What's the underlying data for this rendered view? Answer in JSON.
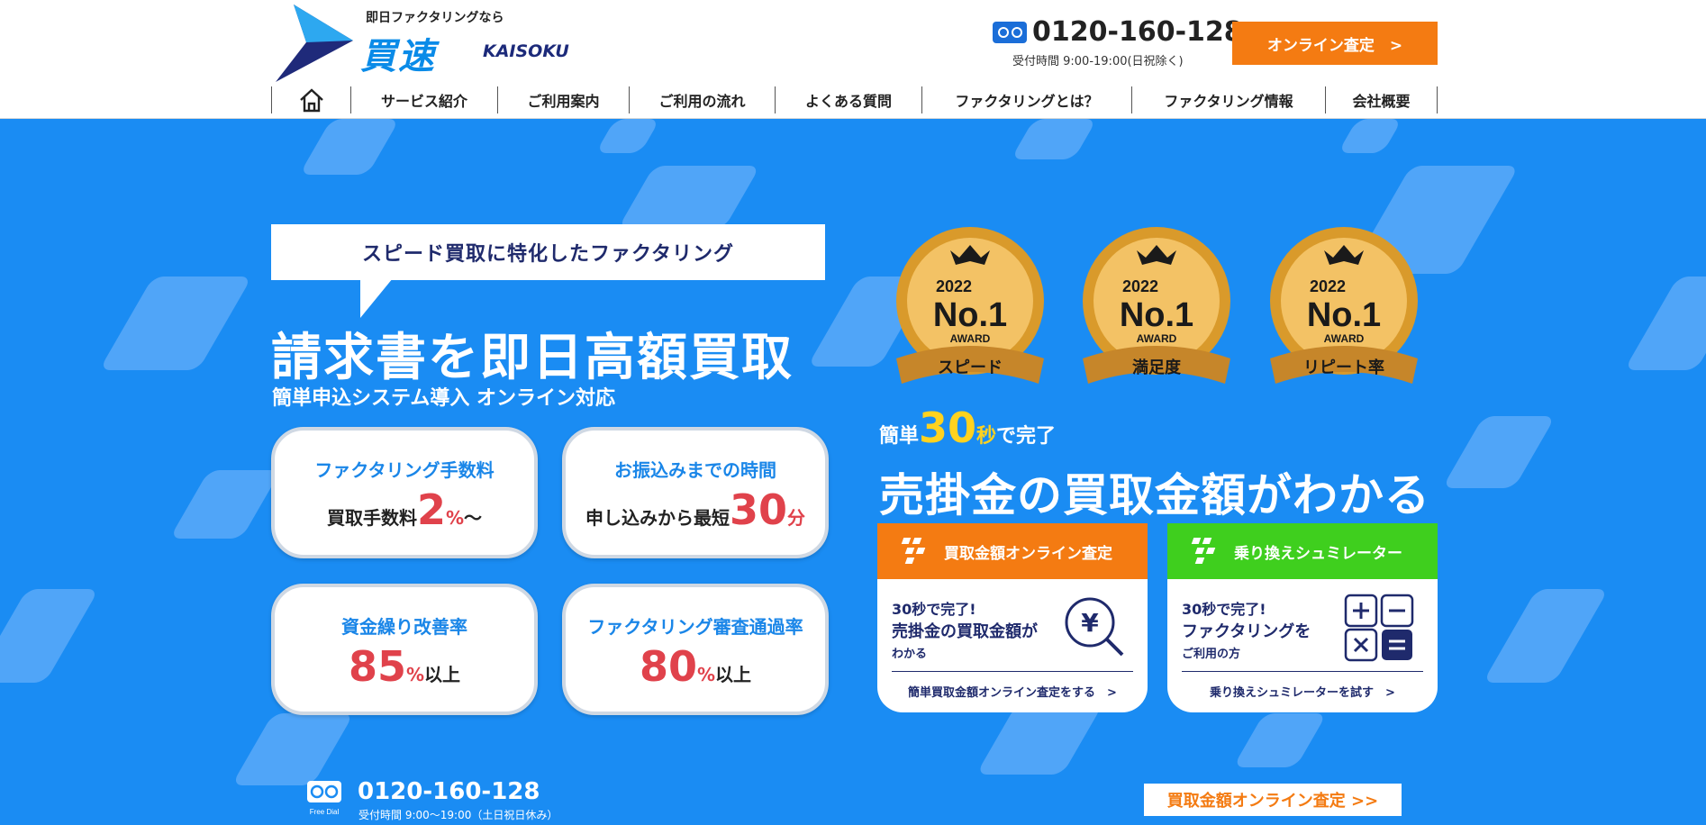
{
  "header": {
    "tagline": "即日ファクタリングなら",
    "brand": "買速",
    "brand_en": "KAISOKU",
    "phone": "0120-160-128",
    "hours": "受付時間 9:00-19:00(日祝除く)",
    "cta": "オンライン査定　>"
  },
  "nav": {
    "items": [
      "サービス紹介",
      "ご利用案内",
      "ご利用の流れ",
      "よくある質問",
      "ファクタリングとは？",
      "ファクタリング情報",
      "会社概要"
    ]
  },
  "hero": {
    "bubble": "スピード買取に特化したファクタリング",
    "headline": "請求書を即日高額買取",
    "subhead": "簡単申込システム導入 オンライン対応"
  },
  "stats": [
    {
      "title": "ファクタリング手数料",
      "prefix": "買取手数料",
      "value": "2",
      "unit": "%",
      "suffix": "〜"
    },
    {
      "title": "お振込みまでの時間",
      "prefix": "申し込みから最短",
      "value": "30",
      "unit": "分",
      "suffix": ""
    },
    {
      "title": "資金繰り改善率",
      "prefix": "",
      "value": "85",
      "unit": "%",
      "suffix": "以上"
    },
    {
      "title": "ファクタリング審査通過率",
      "prefix": "",
      "value": "80",
      "unit": "%",
      "suffix": "以上"
    }
  ],
  "awards": [
    {
      "year": "2022",
      "rank": "No.1",
      "award": "AWARD",
      "category": "スピード"
    },
    {
      "year": "2022",
      "rank": "No.1",
      "award": "AWARD",
      "category": "満足度"
    },
    {
      "year": "2022",
      "rank": "No.1",
      "award": "AWARD",
      "category": "リピート率"
    }
  ],
  "promo": {
    "prefix": "簡単",
    "number": "30",
    "sec": "秒",
    "suffix": "で完了",
    "message": "売掛金の買取金額がわかる"
  },
  "cards": [
    {
      "head": "買取金額オンライン査定",
      "color": "#f47b12",
      "l1": "30秒で完了!",
      "l2": "売掛金の買取金額が",
      "l3": "わかる",
      "link": "簡単買取金額オンライン査定をする　>"
    },
    {
      "head": "乗り換えシュミレーター",
      "color": "#3fcf1e",
      "l1": "30秒で完了!",
      "l2": "ファクタリングを",
      "l3": "ご利用の方",
      "link": "乗り換えシュミレーターを試す　>"
    }
  ],
  "footer": {
    "free_dial": "Free Dial",
    "phone": "0120-160-128",
    "hours": "受付時間 9:00〜19:00（土日祝日休み）",
    "cta": "買取金額オンライン査定 >>"
  }
}
